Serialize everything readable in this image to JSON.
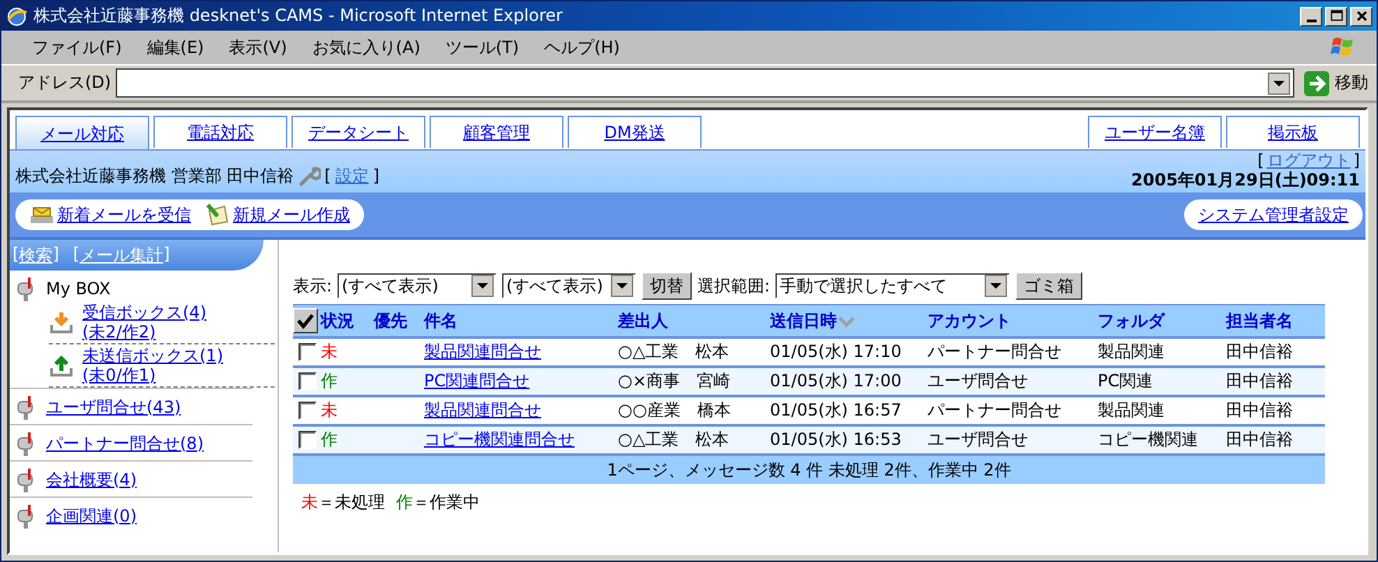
{
  "window": {
    "title": "株式会社近藤事務機 desknet's CAMS - Microsoft Internet Explorer"
  },
  "menu": [
    "ファイル(F)",
    "編集(E)",
    "表示(V)",
    "お気に入り(A)",
    "ツール(T)",
    "ヘルプ(H)"
  ],
  "address_bar": {
    "label": "アドレス(D)",
    "go": "移動"
  },
  "tabs": [
    {
      "label": "メール対応",
      "selected": true
    },
    {
      "label": "電話対応",
      "selected": false
    },
    {
      "label": "データシート",
      "selected": false
    },
    {
      "label": "顧客管理",
      "selected": false
    },
    {
      "label": "DM発送",
      "selected": false
    }
  ],
  "right_tabs": [
    {
      "label": "ユーザー名簿",
      "selected": false
    },
    {
      "label": "掲示板",
      "selected": false
    }
  ],
  "user_bar": {
    "user": "株式会社近藤事務機 営業部 田中信裕",
    "settings": {
      "open": "[",
      "label": "設定",
      "close": "]"
    },
    "logout": {
      "open": "[",
      "label": "ログアウト",
      "close": "]"
    },
    "datetime": "2005年01月29日(土)09:11"
  },
  "toolbar": {
    "actions": [
      {
        "label": "新着メールを受信",
        "kind": "receive"
      },
      {
        "label": "新規メール作成",
        "kind": "compose"
      }
    ],
    "admin": "システム管理者設定"
  },
  "sidebar": {
    "links": [
      {
        "open": "[",
        "label": "検索",
        "close": "]"
      },
      {
        "open": "[",
        "label": "メール集計",
        "close": "]"
      }
    ],
    "mybox": {
      "label": "My BOX",
      "children": [
        {
          "label": "受信ボックス(4)",
          "counts": "(未2/作2)",
          "kind": "inbox"
        },
        {
          "label": "未送信ボックス(1)",
          "counts": "(未0/作1)",
          "kind": "outbox"
        }
      ]
    },
    "folders": [
      "ユーザ問合せ(43)",
      "パートナー問合せ(8)",
      "会社概要(4)",
      "企画関連(0)"
    ]
  },
  "filters": {
    "show_label": "表示:",
    "select_1": "(すべて表示)",
    "select_2": "(すべて表示)",
    "switch_button": "切替",
    "range_label": "選択範囲:",
    "range": "手動で選択したすべて",
    "trash_button": "ゴミ箱"
  },
  "table": {
    "select_all_checked": true,
    "columns": [
      {
        "label": "状況",
        "sorted": false
      },
      {
        "label": "優先",
        "sorted": false
      },
      {
        "label": "件名",
        "sorted": false
      },
      {
        "label": "差出人",
        "sorted": false
      },
      {
        "label": "送信日時",
        "sorted": true
      },
      {
        "label": "アカウント",
        "sorted": false
      },
      {
        "label": "フォルダ",
        "sorted": false
      },
      {
        "label": "担当者名",
        "sorted": false
      }
    ],
    "rows": [
      {
        "checked": false,
        "status": "未",
        "color": "#ff0000",
        "subject": "製品関連問合せ",
        "sender": "○△工業　松本",
        "sent": "01/05(水) 17:10",
        "account": "パートナー問合せ",
        "folder": "製品関連",
        "assignee": "田中信裕"
      },
      {
        "checked": false,
        "status": "作",
        "color": "#008000",
        "subject": "PC関連問合せ",
        "sender": "○×商事　宮崎",
        "sent": "01/05(水) 17:00",
        "account": "ユーザ問合せ",
        "folder": "PC関連",
        "assignee": "田中信裕"
      },
      {
        "checked": false,
        "status": "未",
        "color": "#ff0000",
        "subject": "製品関連問合せ",
        "sender": "○○産業　橋本",
        "sent": "01/05(水) 16:57",
        "account": "パートナー問合せ",
        "folder": "製品関連",
        "assignee": "田中信裕"
      },
      {
        "checked": false,
        "status": "作",
        "color": "#008000",
        "subject": "コピー機関連問合せ",
        "sender": "○△工業　松本",
        "sent": "01/05(水) 16:53",
        "account": "ユーザ問合せ",
        "folder": "コピー機関連",
        "assignee": "田中信裕"
      }
    ],
    "summary": "1ページ、メッセージ数 4 件 未処理 2件、作業中 2件"
  },
  "legend": [
    {
      "mark": "未",
      "color": "#ff0000",
      "text": "＝未処理"
    },
    {
      "mark": "作",
      "color": "#008000",
      "text": "＝作業中"
    }
  ]
}
